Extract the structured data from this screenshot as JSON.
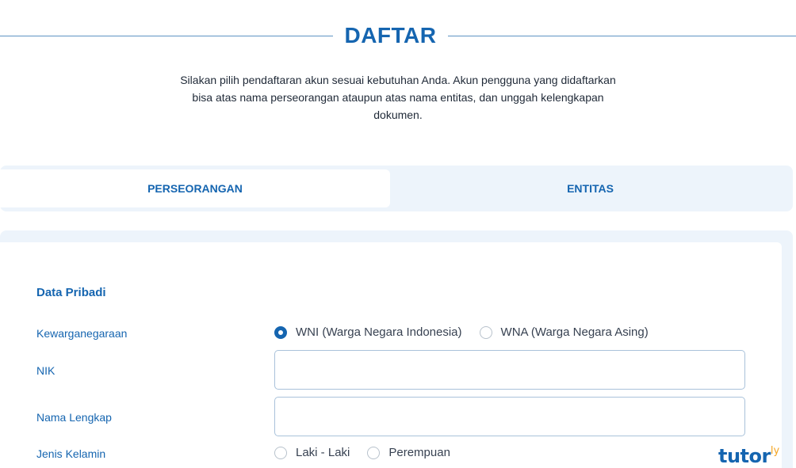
{
  "header": {
    "title": "DAFTAR",
    "intro_line1": "Silakan pilih pendaftaran akun sesuai kebutuhan Anda. Akun pengguna yang didaftarkan",
    "intro_line2": "bisa atas nama perseorangan ataupun atas nama entitas, dan unggah kelengkapan",
    "intro_line3": "dokumen."
  },
  "tabs": [
    {
      "label": "PERSEORANGAN",
      "active": true
    },
    {
      "label": "ENTITAS",
      "active": false
    }
  ],
  "form": {
    "section_title": "Data Pribadi",
    "citizenship": {
      "label": "Kewarganegaraan",
      "options": [
        {
          "label": "WNI (Warga Negara Indonesia)",
          "selected": true
        },
        {
          "label": "WNA (Warga Negara Asing)",
          "selected": false
        }
      ]
    },
    "nik": {
      "label": "NIK",
      "value": "",
      "placeholder": ""
    },
    "full_name": {
      "label": "Nama Lengkap",
      "value": "",
      "placeholder": ""
    },
    "gender": {
      "label": "Jenis Kelamin",
      "options": [
        {
          "label": "Laki - Laki",
          "selected": false
        },
        {
          "label": "Perempuan",
          "selected": false
        }
      ]
    }
  },
  "watermark": {
    "brand": "tutor",
    "brand_suffix": "ly"
  },
  "colors": {
    "primary": "#1565b0",
    "tab_background": "#edf4fb",
    "input_border": "#a9c2da",
    "watermark_accent": "#f4a522"
  }
}
